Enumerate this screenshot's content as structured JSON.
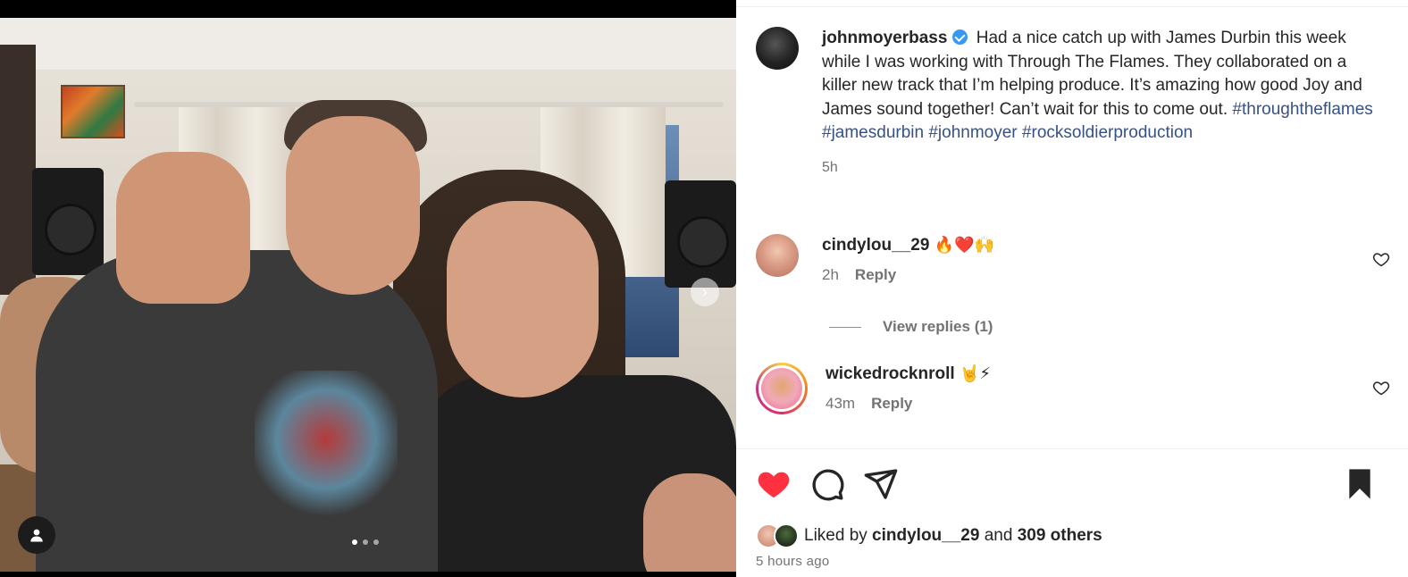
{
  "post": {
    "username": "johnmoyerbass",
    "caption_text": "Had a nice catch up with James Durbin this week while I was working with Through The Flames. They collaborated on a killer new track that I’m helping produce. It’s amazing how good Joy and James sound together! Can’t wait for this to come out.",
    "hashtags": [
      "#throughtheflames",
      "#jamesdurbin",
      "#johnmoyer",
      "#rocksoldierproduction"
    ],
    "time_ago": "5h"
  },
  "comments": [
    {
      "username": "cindylou__29",
      "text": "🔥❤️🙌",
      "time": "2h",
      "reply_label": "Reply"
    },
    {
      "username": "wickedrocknroll",
      "text": "🤘⚡",
      "time": "43m",
      "reply_label": "Reply"
    }
  ],
  "view_replies": "View replies (1)",
  "likes": {
    "prefix": "Liked by ",
    "user": "cindylou__29",
    "middle": " and ",
    "others": "309 others"
  },
  "posted_time": "5 hours ago",
  "media": {
    "carousel_count": 3,
    "active_index": 0
  },
  "icons": {
    "like": "heart-filled-icon",
    "comment": "comment-bubble-icon",
    "share": "paper-plane-icon",
    "save": "bookmark-filled-icon",
    "user_tags": "user-tag-icon",
    "next": "chevron-right-icon"
  },
  "colors": {
    "like_red": "#ff3040",
    "hashtag_blue": "#385185",
    "verified_blue": "#3897f0",
    "muted_text": "#737373"
  }
}
